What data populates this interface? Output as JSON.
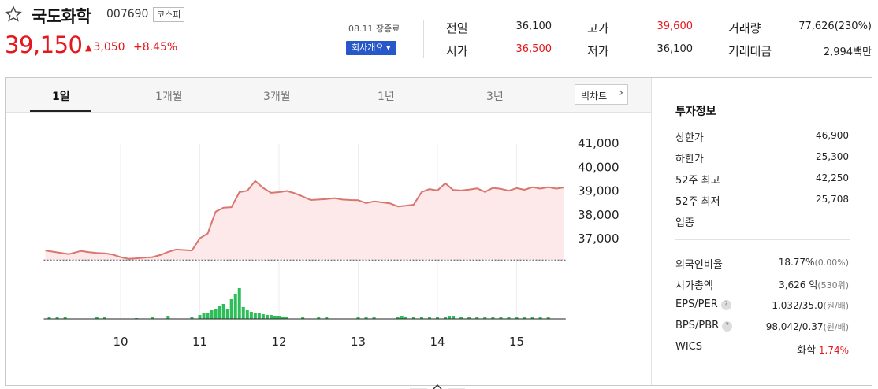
{
  "stock": {
    "name": "국도화학",
    "code": "007690",
    "market": "코스피",
    "price": "39,150",
    "change_arrow": "▲",
    "change": "3,050",
    "change_pct": "+8.45%",
    "market_status": "08.11 장종료",
    "company_button": "회사개요 ▾"
  },
  "quote": {
    "prev_label": "전일",
    "prev": "36,100",
    "high_label": "고가",
    "high": "39,600",
    "volume_label": "거래량",
    "volume": "77,626(230%)",
    "open_label": "시가",
    "open": "36,500",
    "low_label": "저가",
    "low": "36,100",
    "amount_label": "거래대금",
    "amount": "2,994백만"
  },
  "tabs": [
    "1일",
    "1개월",
    "3개월",
    "1년",
    "3년"
  ],
  "active_tab": 0,
  "bigchart_button": "빅차트",
  "chart_data": {
    "type": "line",
    "x_ticks": [
      "10",
      "11",
      "12",
      "13",
      "14",
      "15"
    ],
    "y_ticks": [
      "41,000",
      "40,000",
      "39,000",
      "38,000",
      "37,000"
    ],
    "ylim": [
      36000,
      41500
    ],
    "baseline": 36100,
    "x_start": 9.05,
    "x_end": 15.6,
    "x": [
      9.05,
      9.2,
      9.35,
      9.5,
      9.6,
      9.7,
      9.8,
      9.9,
      10.0,
      10.1,
      10.2,
      10.3,
      10.4,
      10.5,
      10.6,
      10.7,
      10.8,
      10.9,
      11.0,
      11.1,
      11.2,
      11.3,
      11.4,
      11.5,
      11.6,
      11.7,
      11.8,
      11.9,
      12.0,
      12.1,
      12.2,
      12.3,
      12.4,
      12.5,
      12.6,
      12.7,
      12.8,
      12.9,
      13.0,
      13.1,
      13.2,
      13.3,
      13.4,
      13.5,
      13.6,
      13.7,
      13.8,
      13.9,
      14.0,
      14.1,
      14.2,
      14.3,
      14.4,
      14.5,
      14.6,
      14.7,
      14.8,
      14.9,
      15.0,
      15.1,
      15.2,
      15.3,
      15.4,
      15.5,
      15.6
    ],
    "price": [
      36500,
      36420,
      36350,
      36480,
      36430,
      36400,
      36380,
      36330,
      36220,
      36150,
      36170,
      36200,
      36220,
      36310,
      36440,
      36540,
      36520,
      36500,
      37010,
      37210,
      38130,
      38300,
      38320,
      38950,
      39010,
      39420,
      39130,
      38920,
      38950,
      39000,
      38900,
      38770,
      38620,
      38640,
      38660,
      38700,
      38640,
      38620,
      38610,
      38490,
      38560,
      38520,
      38480,
      38350,
      38380,
      38420,
      38950,
      39080,
      39020,
      39320,
      39040,
      39020,
      39060,
      39110,
      38960,
      39130,
      39090,
      39010,
      39120,
      39050,
      39160,
      39100,
      39160,
      39100,
      39150
    ],
    "volume_ticks": [
      9.1,
      9.2,
      9.3,
      9.7,
      9.8,
      10.2,
      10.4,
      10.6,
      10.9,
      11.0,
      11.05,
      11.1,
      11.15,
      11.2,
      11.25,
      11.3,
      11.35,
      11.4,
      11.45,
      11.5,
      11.55,
      11.6,
      11.65,
      11.7,
      11.75,
      11.8,
      11.85,
      11.9,
      11.95,
      12.0,
      12.05,
      12.1,
      12.3,
      12.5,
      12.6,
      13.0,
      13.1,
      13.2,
      13.5,
      13.55,
      13.6,
      13.7,
      13.8,
      13.9,
      14.0,
      14.1,
      14.15,
      14.2,
      14.3,
      14.4,
      14.5,
      14.6,
      14.7,
      14.8,
      14.9,
      15.0,
      15.1,
      15.2,
      15.3,
      15.4
    ],
    "volume": [
      3,
      3,
      2,
      2,
      2,
      1,
      2,
      4,
      2,
      5,
      7,
      8,
      11,
      12,
      16,
      19,
      13,
      25,
      32,
      39,
      15,
      11,
      9,
      8,
      7,
      6,
      5,
      5,
      4,
      4,
      3,
      3,
      2,
      2,
      2,
      2,
      2,
      2,
      3,
      4,
      3,
      3,
      3,
      3,
      3,
      3,
      4,
      4,
      3,
      3,
      3,
      3,
      3,
      3,
      3,
      3,
      3,
      3,
      3,
      2
    ],
    "line_color": "#d9766f",
    "fill_color": "#fde9e9",
    "volume_color": "#2ebd59"
  },
  "info": {
    "title": "투자정보",
    "rows1": [
      {
        "label": "상한가",
        "value": "46,900",
        "color": "red"
      },
      {
        "label": "하한가",
        "value": "25,300",
        "color": "blue"
      },
      {
        "label": "52주 최고",
        "value": "42,250",
        "color": ""
      },
      {
        "label": "52주 최저",
        "value": "25,708",
        "color": ""
      },
      {
        "label": "업종",
        "value": "",
        "color": ""
      }
    ],
    "rows2": [
      {
        "label": "외국인비율",
        "value": "18.77%",
        "sub": "(0.00%)",
        "q": false
      },
      {
        "label": "시가총액",
        "value": "3,626 억",
        "sub": "(530위)",
        "q": false
      },
      {
        "label": "EPS/PER",
        "value": "1,032/35.0",
        "sub": "(원/배)",
        "q": true
      },
      {
        "label": "BPS/PBR",
        "value": "98,042/0.37",
        "sub": "(원/배)",
        "q": true
      }
    ],
    "wics_label": "WICS",
    "wics_value": "화학",
    "wics_pct": "1.74%"
  }
}
